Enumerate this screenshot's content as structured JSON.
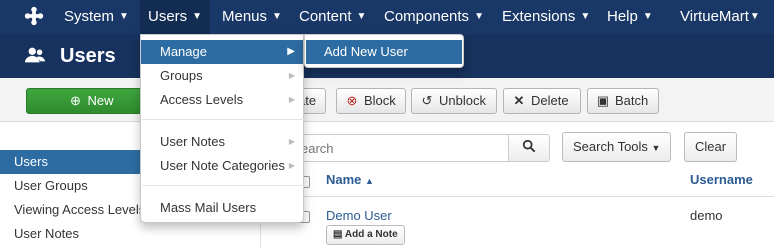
{
  "nav": {
    "logo_icon": "joomla-logo-icon",
    "items": [
      {
        "label": "System"
      },
      {
        "label": "Users"
      },
      {
        "label": "Menus"
      },
      {
        "label": "Content"
      },
      {
        "label": "Components"
      },
      {
        "label": "Extensions"
      },
      {
        "label": "Help"
      },
      {
        "label": "VirtueMart"
      }
    ]
  },
  "titlebar": {
    "icon": "users-icon",
    "title": "Users"
  },
  "toolbar": {
    "new_label": "New",
    "activate_label": "ate",
    "block_label": "Block",
    "unblock_label": "Unblock",
    "delete_label": "Delete",
    "batch_label": "Batch"
  },
  "sidebar": {
    "items": [
      {
        "label": "Users",
        "active": true
      },
      {
        "label": "User Groups"
      },
      {
        "label": "Viewing Access Levels"
      },
      {
        "label": "User Notes"
      }
    ]
  },
  "filter": {
    "search_placeholder": "earch",
    "search_tools_label": "Search Tools",
    "clear_label": "Clear"
  },
  "table": {
    "columns": {
      "name": "Name",
      "username": "Username"
    },
    "sort_indicator": "▲",
    "rows": [
      {
        "name": "Demo User",
        "username": "demo",
        "note_button": "Add a Note"
      }
    ]
  },
  "menu": {
    "items": [
      {
        "label": "Manage"
      },
      {
        "label": "Groups"
      },
      {
        "label": "Access Levels"
      },
      {
        "label": "User Notes"
      },
      {
        "label": "User Note Categories"
      },
      {
        "label": "Mass Mail Users"
      }
    ],
    "submenu": {
      "label": "Add New User"
    }
  },
  "colors": {
    "navbar": "#1a3867",
    "titlebar": "#17325e",
    "highlight": "#2d6ca2",
    "new_button": "#3fa73f",
    "link": "#2b5b92"
  }
}
